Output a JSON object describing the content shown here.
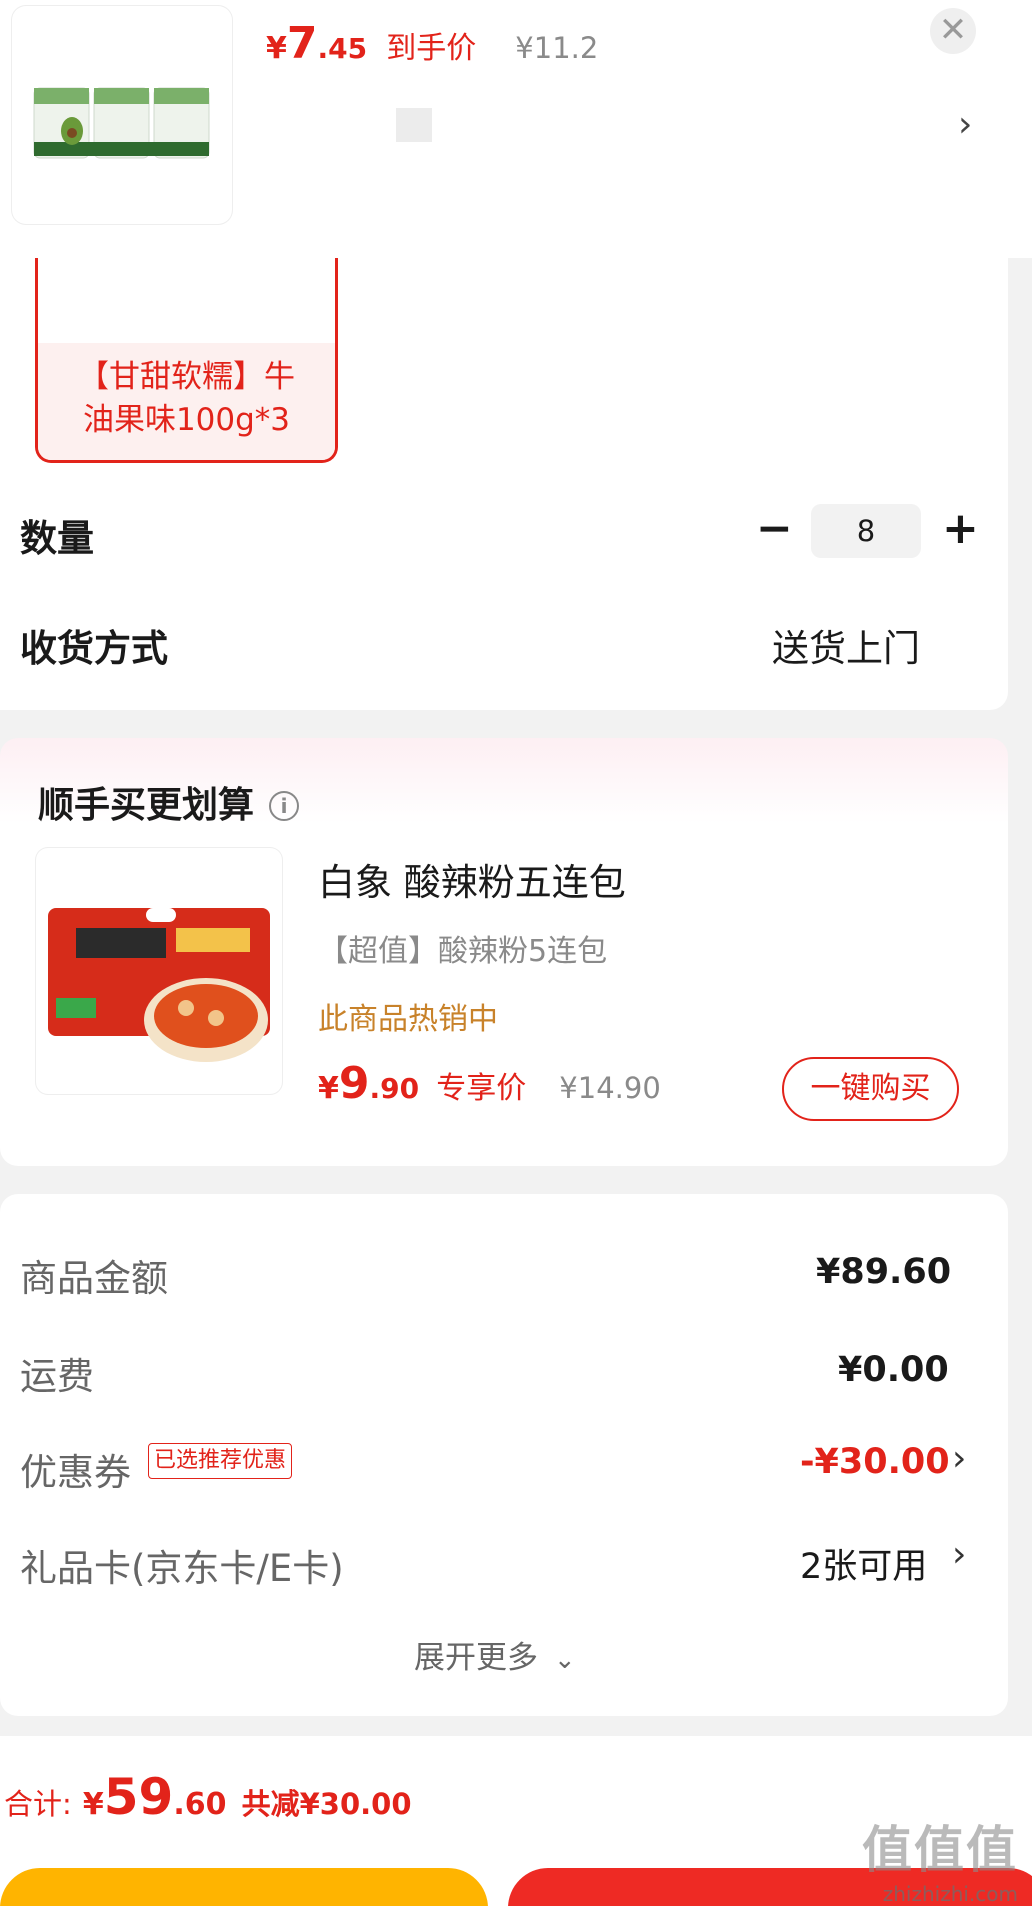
{
  "top_product": {
    "price_symbol": "¥",
    "price_int": "7",
    "price_dec": ".45",
    "price_tag": "到手价",
    "original_price": "¥11.2",
    "close_icon": "close-icon",
    "more_icon": "chevron-right-icon"
  },
  "spec_option": {
    "label": "【甘甜软糯】牛油果味100g*3"
  },
  "quantity": {
    "label": "数量",
    "value": "8",
    "minus": "−",
    "plus": "+"
  },
  "delivery": {
    "label": "收货方式",
    "value": "送货上门"
  },
  "addon": {
    "title": "顺手买更划算",
    "info_icon": "info-icon",
    "product_name": "白象 酸辣粉五连包",
    "product_desc": "【超值】酸辣粉5连包",
    "hot_text": "此商品热销中",
    "price_symbol": "¥",
    "price_int": "9",
    "price_dec": ".90",
    "price_tag": "专享价",
    "original_price": "¥14.90",
    "buy_button": "一键购买"
  },
  "summary": {
    "goods_label": "商品金额",
    "goods_value": "¥89.60",
    "shipping_label": "运费",
    "shipping_value": "¥0.00",
    "coupon_label": "优惠券",
    "coupon_badge": "已选推荐优惠",
    "coupon_value": "-¥30.00",
    "giftcard_label": "礼品卡(京东卡/E卡)",
    "giftcard_value": "2张可用",
    "expand_label": "展开更多"
  },
  "footer": {
    "total_label": "合计:",
    "total_symbol": "¥",
    "total_int": "59",
    "total_dec": ".60",
    "saved_text": "共减¥30.00"
  },
  "watermark": {
    "logo_text": "值值值",
    "site": "zhizhizhi.com"
  },
  "colors": {
    "accent_red": "#e2231a",
    "hot_orange": "#c8822a",
    "button_yellow": "#ffb400"
  }
}
